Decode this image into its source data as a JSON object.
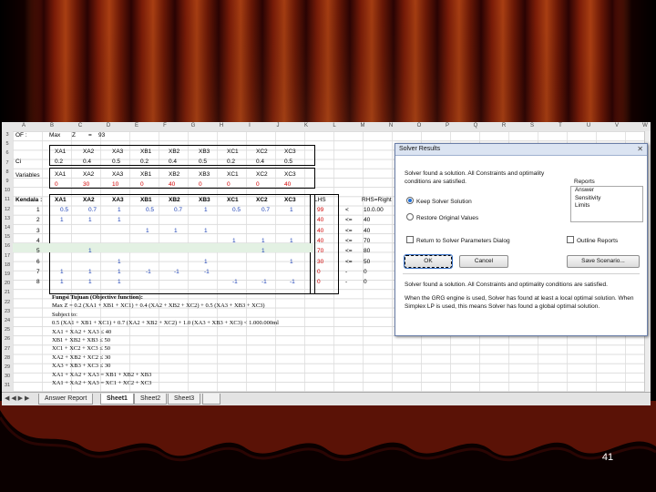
{
  "slide": {
    "number": "41"
  },
  "sheet": {
    "columns": [
      "A",
      "B",
      "C",
      "D",
      "E",
      "F",
      "G",
      "H",
      "I",
      "J",
      "K",
      "L",
      "M",
      "N",
      "O",
      "P",
      "Q",
      "R",
      "S",
      "T",
      "U",
      "V",
      "W"
    ],
    "row_numbers": [
      "3",
      "5",
      "6",
      "7",
      "8",
      "9",
      "10",
      "11",
      "12",
      "13",
      "14",
      "15",
      "16",
      "17",
      "18",
      "19",
      "20",
      "21",
      "22",
      "23",
      "24",
      "25",
      "26",
      "27",
      "28",
      "29",
      "30",
      "31",
      "32",
      "33"
    ],
    "of_label": "OF :",
    "of_row": [
      "Max",
      "Z",
      "=",
      "93"
    ],
    "ci_label": "Ci",
    "ci_vars": [
      "XA1",
      "XA2",
      "XA3",
      "XB1",
      "XB2",
      "XB3",
      "XC1",
      "XC2",
      "XC3"
    ],
    "ci_values": [
      "0.2",
      "0.4",
      "0.5",
      "0.2",
      "0.4",
      "0.5",
      "0.2",
      "0.4",
      "0.5"
    ],
    "variables_label": "Variables",
    "variables_vars": [
      "XA1",
      "XA2",
      "XA3",
      "XB1",
      "XB2",
      "XB3",
      "XC1",
      "XC2",
      "XC3"
    ],
    "variables_values": [
      "0",
      "30",
      "10",
      "0",
      "40",
      "0",
      "0",
      "0",
      "40"
    ],
    "kendala_label": "Kendala :",
    "kendala_head": [
      "XA1",
      "XA2",
      "XA3",
      "XB1",
      "XB2",
      "XB3",
      "XC1",
      "XC2",
      "XC3"
    ],
    "lhs_label": "LHS",
    "rhs_label": "RHS=Right",
    "constraint_rows": [
      {
        "idx": "1",
        "cells": [
          "0.5",
          "0.7",
          "1",
          "0.5",
          "0.7",
          "1",
          "0.5",
          "0.7",
          "1"
        ],
        "lhs": "99",
        "op": "<",
        "rhs": "10.0.00"
      },
      {
        "idx": "2",
        "cells": [
          "1",
          "1",
          "1",
          "",
          "",
          "",
          "",
          "",
          ""
        ],
        "lhs": "40",
        "op": "<=",
        "rhs": "40"
      },
      {
        "idx": "3",
        "cells": [
          "",
          "",
          "",
          "1",
          "1",
          "1",
          "",
          "",
          ""
        ],
        "lhs": "40",
        "op": "<=",
        "rhs": "40"
      },
      {
        "idx": "4",
        "cells": [
          "",
          "",
          "",
          "",
          "",
          "",
          "1",
          "1",
          "1"
        ],
        "lhs": "40",
        "op": "<=",
        "rhs": "70"
      },
      {
        "idx": "5",
        "cells": [
          "",
          "1",
          "",
          "",
          "",
          "",
          "",
          "1",
          ""
        ],
        "lhs": "70",
        "op": "<=",
        "rhs": "80"
      },
      {
        "idx": "6",
        "cells": [
          "",
          "",
          "1",
          "",
          "",
          "1",
          "",
          "",
          "1"
        ],
        "lhs": "30",
        "op": "<=",
        "rhs": "50"
      },
      {
        "idx": "7",
        "cells": [
          "1",
          "1",
          "1",
          "-1",
          "-1",
          "-1",
          "",
          "",
          ""
        ],
        "lhs": "0",
        "op": "-",
        "rhs": "0"
      },
      {
        "idx": "8",
        "cells": [
          "1",
          "1",
          "1",
          "",
          "",
          "",
          "-1",
          "-1",
          "-1"
        ],
        "lhs": "0",
        "op": "-",
        "rhs": "0"
      }
    ],
    "notes": [
      "Fungsi Tujuan (Objective function):",
      "Max Z = 0.2 (XA1 + XB1 + XC1) + 0.4 (XA2 + XB2 + XC2) + 0.5 (XA3 + XB3 + XC3)",
      "Subject to:",
      "0.5 (XA1 + XB1 + XC1) + 0.7 (XA2 + XB2 + XC2) + 1.0 (XA3 + XB3 + XC3) < 1.000.000ml",
      "XA1 + XA2 + XA3 ≤ 40",
      "XB1 + XB2 + XB3 ≤ 50",
      "XC1 + XC2 + XC3 ≤ 50",
      "XA2 + XB2 + XC2 ≤ 30",
      "XA3 + XB3 + XC3 ≤ 30",
      "XA1 + XA2 + XA3 = XB1 + XB2 + XB3",
      "XA1 + XA2 + XA3 = XC1 + XC2 + XC3"
    ],
    "tabs": [
      "Answer Report",
      "Sheet1",
      "Sheet2",
      "Sheet3"
    ],
    "tab_nav": "◀ ◀ ▶ ▶"
  },
  "dialog": {
    "title": "Solver Results",
    "message": "Solver found a solution. All Constraints and optimality conditions are satisfied.",
    "reports_label": "Reports",
    "reports": [
      "Answer",
      "Sensitivity",
      "Limits"
    ],
    "keep_label": "Keep Solver Solution",
    "restore_label": "Restore Original Values",
    "return_label": "Return to Solver Parameters Dialog",
    "outline_label": "Outline Reports",
    "ok_label": "OK",
    "cancel_label": "Cancel",
    "save_label": "Save Scenario...",
    "footer1": "Solver found a solution. All Constraints and optimality conditions are satisfied.",
    "footer2": "When the GRG engine is used, Solver has found at least a local optimal solution. When Simplex LP is used, this means Solver has found a global optimal solution."
  }
}
